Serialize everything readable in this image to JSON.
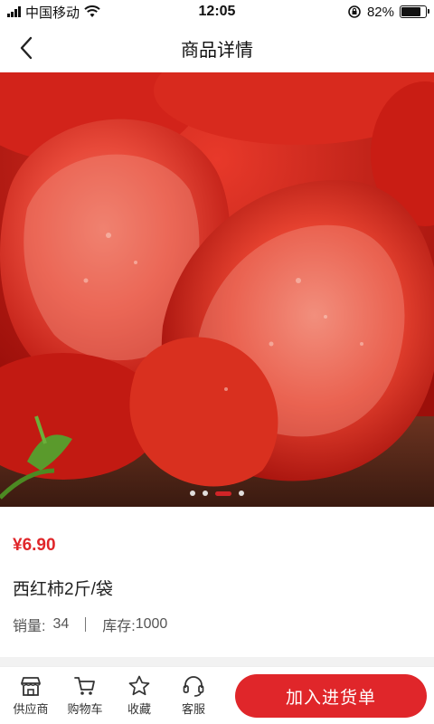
{
  "status_bar": {
    "carrier": "中国移动",
    "time": "12:05",
    "battery_percent": "82%",
    "battery_level": 0.82,
    "icons": [
      "signal-icon",
      "wifi-icon",
      "orientation-lock-icon",
      "battery-icon"
    ]
  },
  "nav": {
    "title": "商品详情",
    "back_icon": "chevron-left-icon"
  },
  "gallery": {
    "image_subject": "tomato-photo",
    "page_count": 4,
    "active_index": 2
  },
  "product": {
    "price": "¥6.90",
    "name": "西红柿2斤/袋",
    "sales_label": "销量:",
    "sales_value": "34",
    "stock_label": "库存:",
    "stock_value": "1000"
  },
  "bottom_bar": {
    "tabs": [
      {
        "label": "供应商",
        "icon": "store-icon"
      },
      {
        "label": "购物车",
        "icon": "cart-icon"
      },
      {
        "label": "收藏",
        "icon": "star-icon"
      },
      {
        "label": "客服",
        "icon": "headset-icon"
      }
    ],
    "cta_label": "加入进货单"
  },
  "colors": {
    "accent": "#e0262a",
    "text": "#222222",
    "muted": "#555555"
  }
}
